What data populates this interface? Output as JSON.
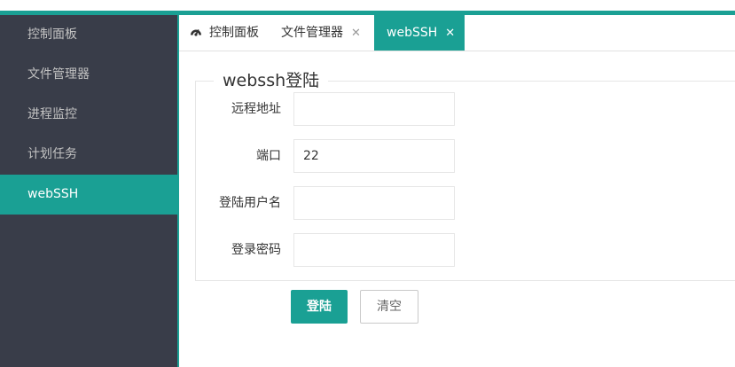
{
  "colors": {
    "accent": "#1aa094",
    "sidebar_bg": "#393d49",
    "sidebar_text": "#c2c2c2"
  },
  "sidebar": {
    "items": [
      {
        "label": "控制面板"
      },
      {
        "label": "文件管理器"
      },
      {
        "label": "进程监控"
      },
      {
        "label": "计划任务"
      },
      {
        "label": "webSSH",
        "active": true
      }
    ]
  },
  "tabs": [
    {
      "label": "控制面板",
      "icon": "dashboard-icon"
    },
    {
      "label": "文件管理器",
      "close": "✕"
    },
    {
      "label": "webSSH",
      "close": "✕",
      "active": true
    }
  ],
  "form": {
    "legend": "webssh登陆",
    "fields": [
      {
        "label": "远程地址",
        "value": ""
      },
      {
        "label": "端口",
        "value": "22"
      },
      {
        "label": "登陆用户名",
        "value": ""
      },
      {
        "label": "登录密码",
        "value": ""
      }
    ],
    "submit_label": "登陆",
    "reset_label": "清空"
  }
}
